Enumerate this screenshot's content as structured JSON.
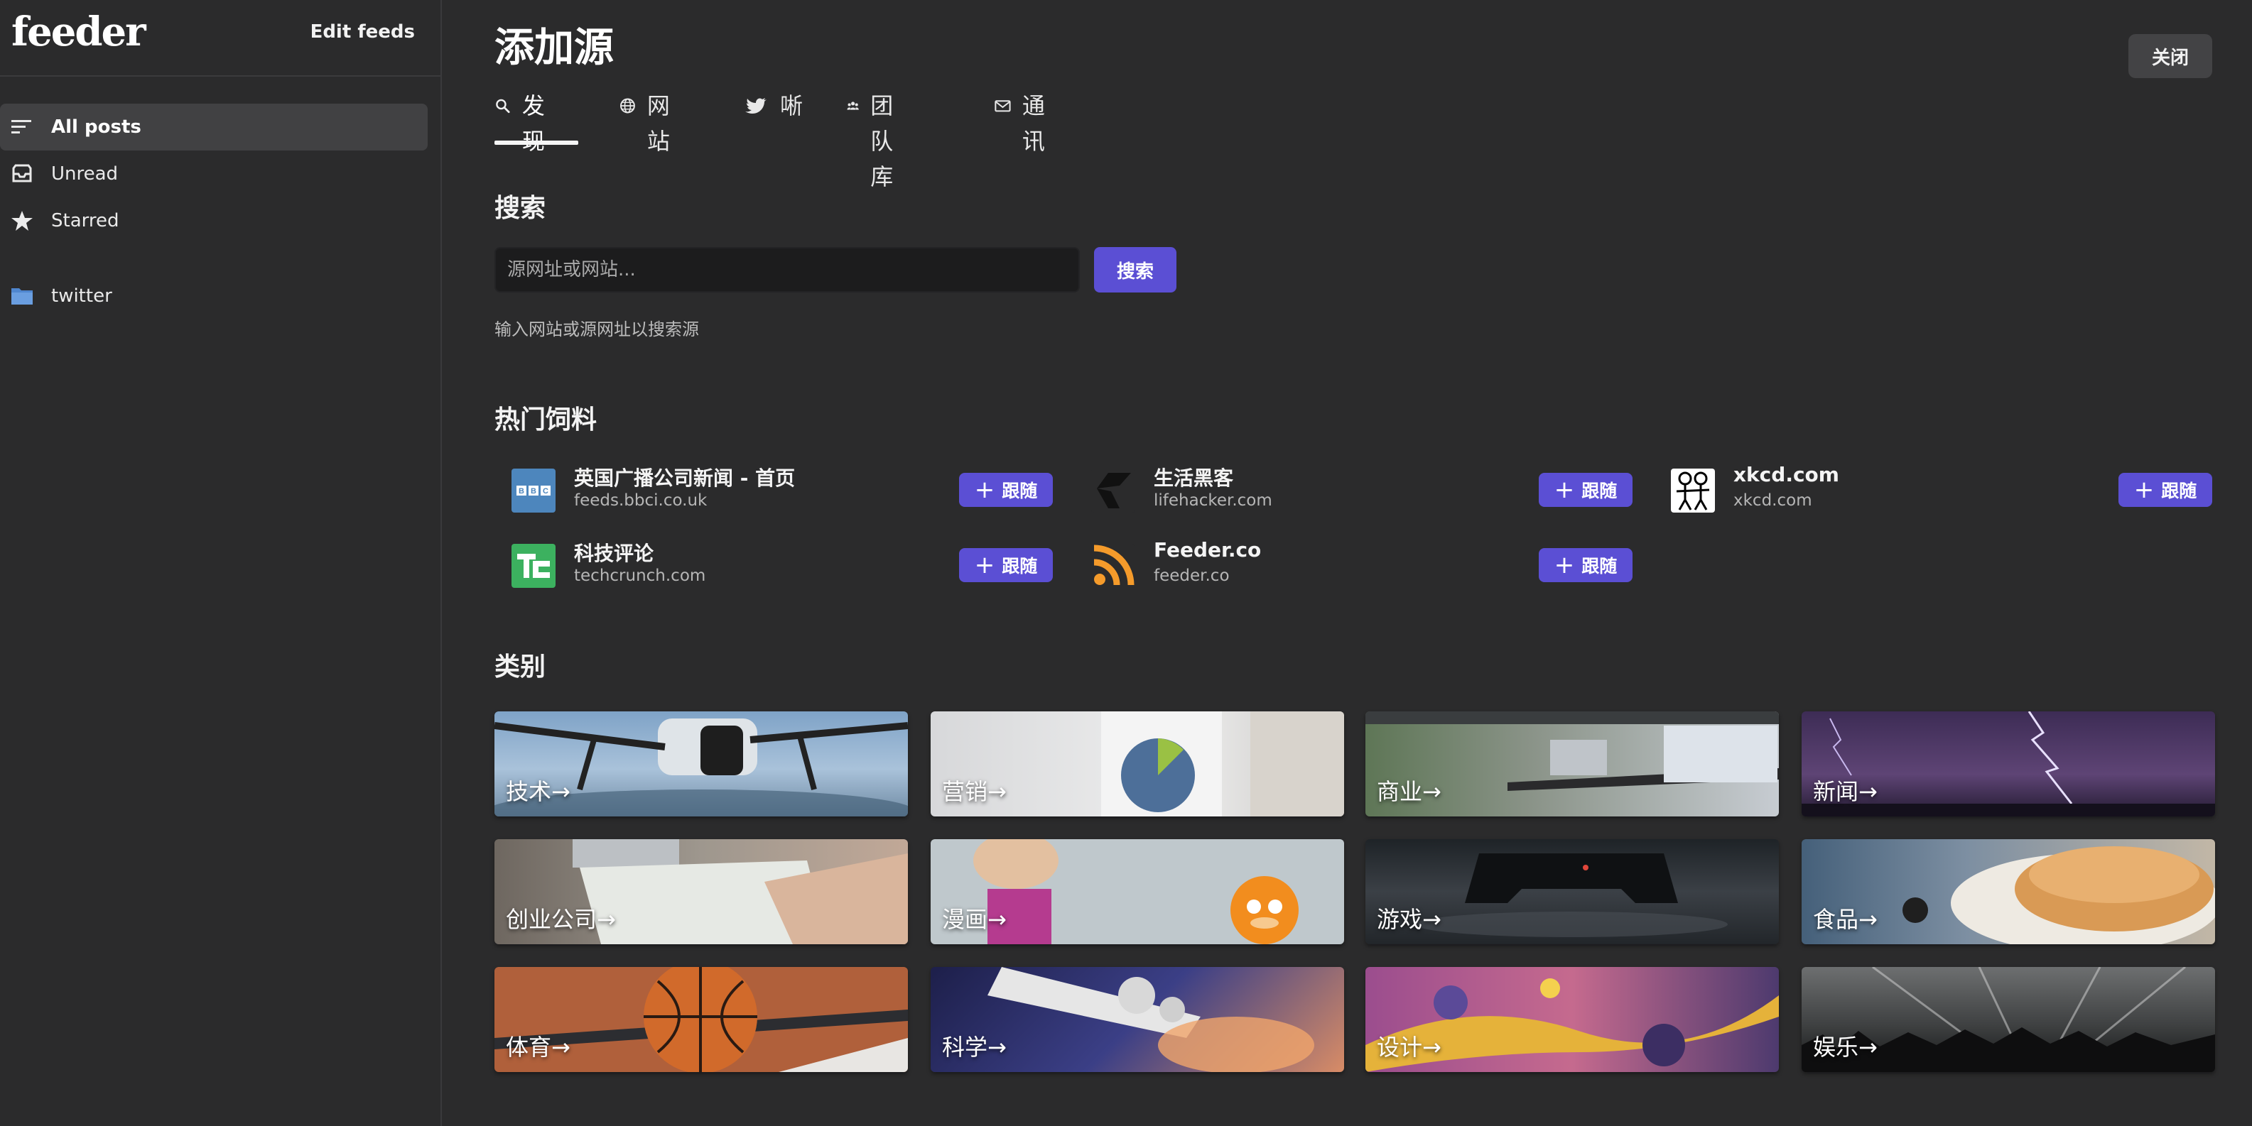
{
  "sidebar": {
    "logo": "feeder",
    "edit_feeds": "Edit feeds",
    "items": [
      {
        "label": "All posts",
        "icon": "list-icon"
      },
      {
        "label": "Unread",
        "icon": "inbox-icon"
      },
      {
        "label": "Starred",
        "icon": "star-icon"
      },
      {
        "label": "twitter",
        "icon": "folder-icon"
      }
    ]
  },
  "main": {
    "title": "添加源",
    "close": "关闭",
    "tabs": [
      {
        "label": "发现",
        "icon": "search-icon"
      },
      {
        "label": "网站",
        "icon": "globe-icon"
      },
      {
        "label": "唽",
        "icon": "twitter-icon"
      },
      {
        "label": "团队库",
        "icon": "team-icon"
      },
      {
        "label": "通讯",
        "icon": "mail-icon"
      }
    ],
    "search": {
      "title": "搜索",
      "placeholder": "源网址或网站...",
      "button": "搜索",
      "hint": "输入网站或源网址以搜索源"
    },
    "popular": {
      "title": "热门饲料",
      "follow_label": "跟随",
      "feeds": [
        {
          "name": "英国广播公司新闻 - 首页",
          "url": "feeds.bbci.co.uk",
          "icon": "bbc-icon"
        },
        {
          "name": "生活黑客",
          "url": "lifehacker.com",
          "icon": "lifehacker-icon"
        },
        {
          "name": "xkcd.com",
          "url": "xkcd.com",
          "icon": "xkcd-icon"
        },
        {
          "name": "科技评论",
          "url": "techcrunch.com",
          "icon": "techcrunch-icon"
        },
        {
          "name": "Feeder.co",
          "url": "feeder.co",
          "icon": "rss-icon"
        }
      ]
    },
    "categories": {
      "title": "类别",
      "items": [
        {
          "label": "技术→"
        },
        {
          "label": "营销→"
        },
        {
          "label": "商业→"
        },
        {
          "label": "新闻→"
        },
        {
          "label": "创业公司→"
        },
        {
          "label": "漫画→"
        },
        {
          "label": "游戏→"
        },
        {
          "label": "食品→"
        },
        {
          "label": "体育→"
        },
        {
          "label": "科学→"
        },
        {
          "label": "设计→"
        },
        {
          "label": "娱乐→"
        }
      ]
    }
  },
  "colors": {
    "background": "#2b2b2c",
    "accent": "#5b4fd4",
    "input_bg": "#1c1c1d",
    "folder": "#5b8fd6"
  }
}
